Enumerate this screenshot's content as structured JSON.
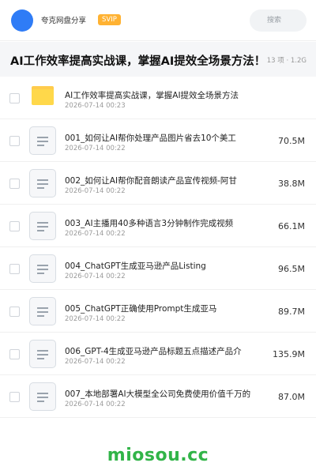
{
  "header": {
    "username": "夸克网盘分享",
    "badge": "SVIP",
    "search_placeholder": "搜索"
  },
  "share": {
    "title": "AI工作效率提高实战课，掌握AI提效全场景方法！",
    "meta": "13 项 · 1.2G"
  },
  "files": [
    {
      "type": "folder",
      "name": "AI工作效率提高实战课，掌握AI提效全场景方法",
      "date": "2026-07-14 00:23",
      "size": ""
    },
    {
      "type": "file",
      "name": "001_如何让AI帮你处理产品图片省去10个美工",
      "date": "2026-07-14 00:22",
      "size": "70.5M"
    },
    {
      "type": "file",
      "name": "002_如何让AI帮你配音朗读产品宣传视频-阿甘",
      "date": "2026-07-14 00:22",
      "size": "38.8M"
    },
    {
      "type": "file",
      "name": "003_AI主播用40多种语言3分钟制作完成视频",
      "date": "2026-07-14 00:22",
      "size": "66.1M"
    },
    {
      "type": "file",
      "name": "004_ChatGPT生成亚马逊产品Listing",
      "date": "2026-07-14 00:22",
      "size": "96.5M"
    },
    {
      "type": "file",
      "name": "005_ChatGPT正确使用Prompt生成亚马",
      "date": "2026-07-14 00:22",
      "size": "89.7M"
    },
    {
      "type": "file",
      "name": "006_GPT-4生成亚马逊产品标题五点描述产品介",
      "date": "2026-07-14 00:22",
      "size": "135.9M"
    },
    {
      "type": "file",
      "name": "007_本地部署AI大模型全公司免费使用价值千万的",
      "date": "2026-07-14 00:22",
      "size": "87.0M"
    }
  ],
  "watermark": "miosou.cc",
  "colors": {
    "accent": "#2f7cf6",
    "badge": "#ffb232",
    "folder": "#ffd84a",
    "watermark": "#31b448"
  }
}
